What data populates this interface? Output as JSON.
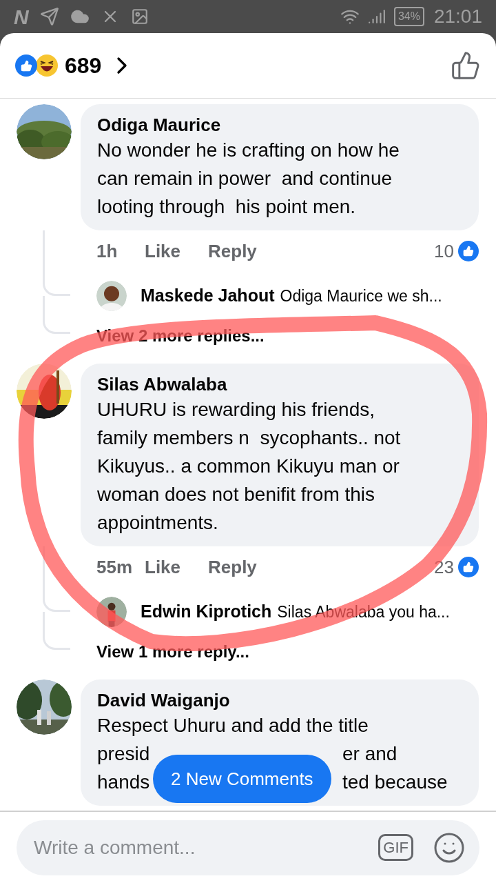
{
  "status_bar": {
    "logo": "N",
    "battery": "34%",
    "time": "21:01"
  },
  "reactions": {
    "count": "689"
  },
  "comments": [
    {
      "author": "Odiga Maurice",
      "lines": [
        "No wonder he is crafting on how he",
        "can remain in power  and continue",
        "looting through  his point men."
      ],
      "time": "1h",
      "like": "Like",
      "reply": "Reply",
      "likes": "10",
      "replies": [
        {
          "author": "Maskede Jahout",
          "text": "Odiga Maurice we sh..."
        }
      ],
      "more": "View 2 more replies..."
    },
    {
      "author": "Silas Abwalaba",
      "lines": [
        "UHURU is rewarding his friends,",
        "family members n  sycophants.. not",
        "Kikuyus.. a common Kikuyu man or",
        "woman does not benifit from this",
        "appointments."
      ],
      "time": "55m",
      "like": "Like",
      "reply": "Reply",
      "likes": "23",
      "replies": [
        {
          "author": "Edwin Kiprotich",
          "text": "Silas Abwalaba you ha..."
        }
      ],
      "more": "View 1 more reply..."
    },
    {
      "author": "David Waiganjo",
      "lines": [
        "Respect Uhuru and add the title"
      ],
      "covered_lines": [
        {
          "left": "presid",
          "right": "er and"
        },
        {
          "left": "hands",
          "right": "ted because"
        }
      ]
    }
  ],
  "new_comments": "2 New Comments",
  "composer": {
    "placeholder": "Write a comment...",
    "gif": "GIF"
  }
}
